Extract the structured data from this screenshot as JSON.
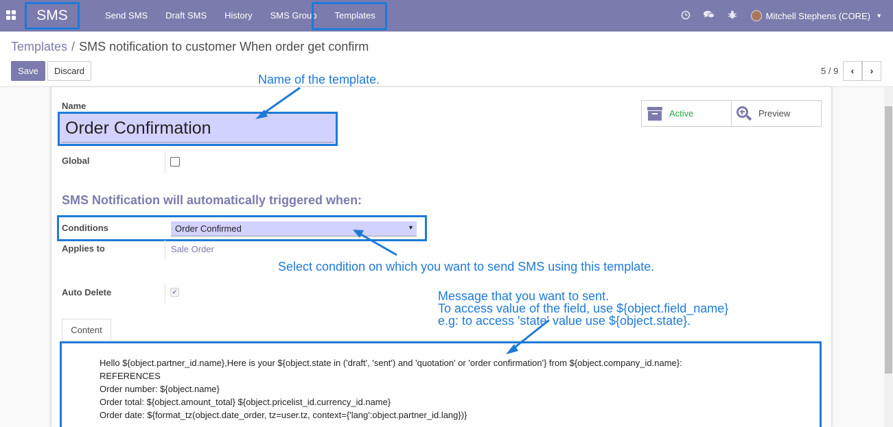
{
  "navbar": {
    "brand": "SMS",
    "menu": [
      "Send SMS",
      "Draft SMS",
      "History",
      "SMS Group",
      "Templates"
    ],
    "user_name": "Mitchell Stephens (CORE)",
    "icons": [
      "clock-icon",
      "chat-icon",
      "bug-icon"
    ]
  },
  "breadcrumb": {
    "parent": "Templates",
    "separator": "/",
    "current": "SMS notification to customer When order get confirm"
  },
  "controls": {
    "save_label": "Save",
    "discard_label": "Discard",
    "pager": "5 / 9"
  },
  "form": {
    "name_label": "Name",
    "name_value": "Order Confirmation",
    "global_label": "Global",
    "active_label": "Active",
    "preview_label": "Preview",
    "section_title": "SMS Notification will automatically triggered when:",
    "conditions_label": "Conditions",
    "conditions_value": "Order Confirmed",
    "applies_to_label": "Applies to",
    "applies_to_value": "Sale Order",
    "auto_delete_label": "Auto Delete",
    "auto_delete_checked": true,
    "global_checked": false,
    "tab_label": "Content",
    "content_lines": [
      "Hello ${object.partner_id.name},Here is your ${object.state in ('draft', 'sent') and 'quotation' or 'order confirmation'} from ${object.company_id.name}:",
      "REFERENCES",
      "Order number: ${object.name}",
      "Order total: ${object.amount_total} ${object.pricelist_id.currency_id.name}",
      "Order date: ${format_tz(object.date_order, tz=user.tz, context={'lang':object.partner_id.lang})}"
    ]
  },
  "annotations": {
    "name_note": "Name of the template.",
    "condition_note": "Select condition on which you want to send SMS using this template.",
    "message_note_1": "Message that you want to sent.",
    "message_note_2": "To access value of the field, use ${object.field_name}",
    "message_note_3": "e.g: to access 'state' value use ${object.state}."
  },
  "colors": {
    "brand": "#7c7bad",
    "annotation": "#1e7ad8",
    "active": "#28a745",
    "input_bg": "#d2d2ff"
  }
}
